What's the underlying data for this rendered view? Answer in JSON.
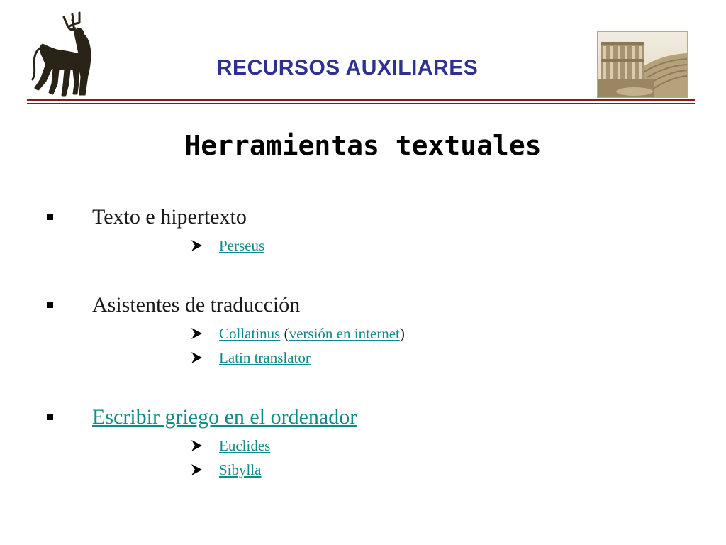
{
  "header": {
    "title": "RECURSOS AUXILIARES"
  },
  "slide": {
    "title": "Herramientas textuales"
  },
  "sections": [
    {
      "label": "Texto e hipertexto",
      "links": [
        {
          "label": "Perseus"
        }
      ]
    },
    {
      "label": "Asistentes de traducción",
      "links": [
        {
          "label": "Collatinus",
          "extra": "versión en internet",
          "open_paren": " (",
          "close_paren": ")"
        },
        {
          "label": "Latin translator"
        }
      ]
    },
    {
      "label": "Escribir griego en el ordenador",
      "links": [
        {
          "label": "Euclides"
        },
        {
          "label": "Sibylla"
        }
      ]
    }
  ],
  "colors": {
    "header_text": "#2e3192",
    "rule": "#8b1a1a",
    "link": "#138a8a",
    "body_text": "#1a1a1a"
  },
  "images": {
    "logo": "centaur-with-trident-logo",
    "photo": "roman-theatre-ruins-photo"
  }
}
